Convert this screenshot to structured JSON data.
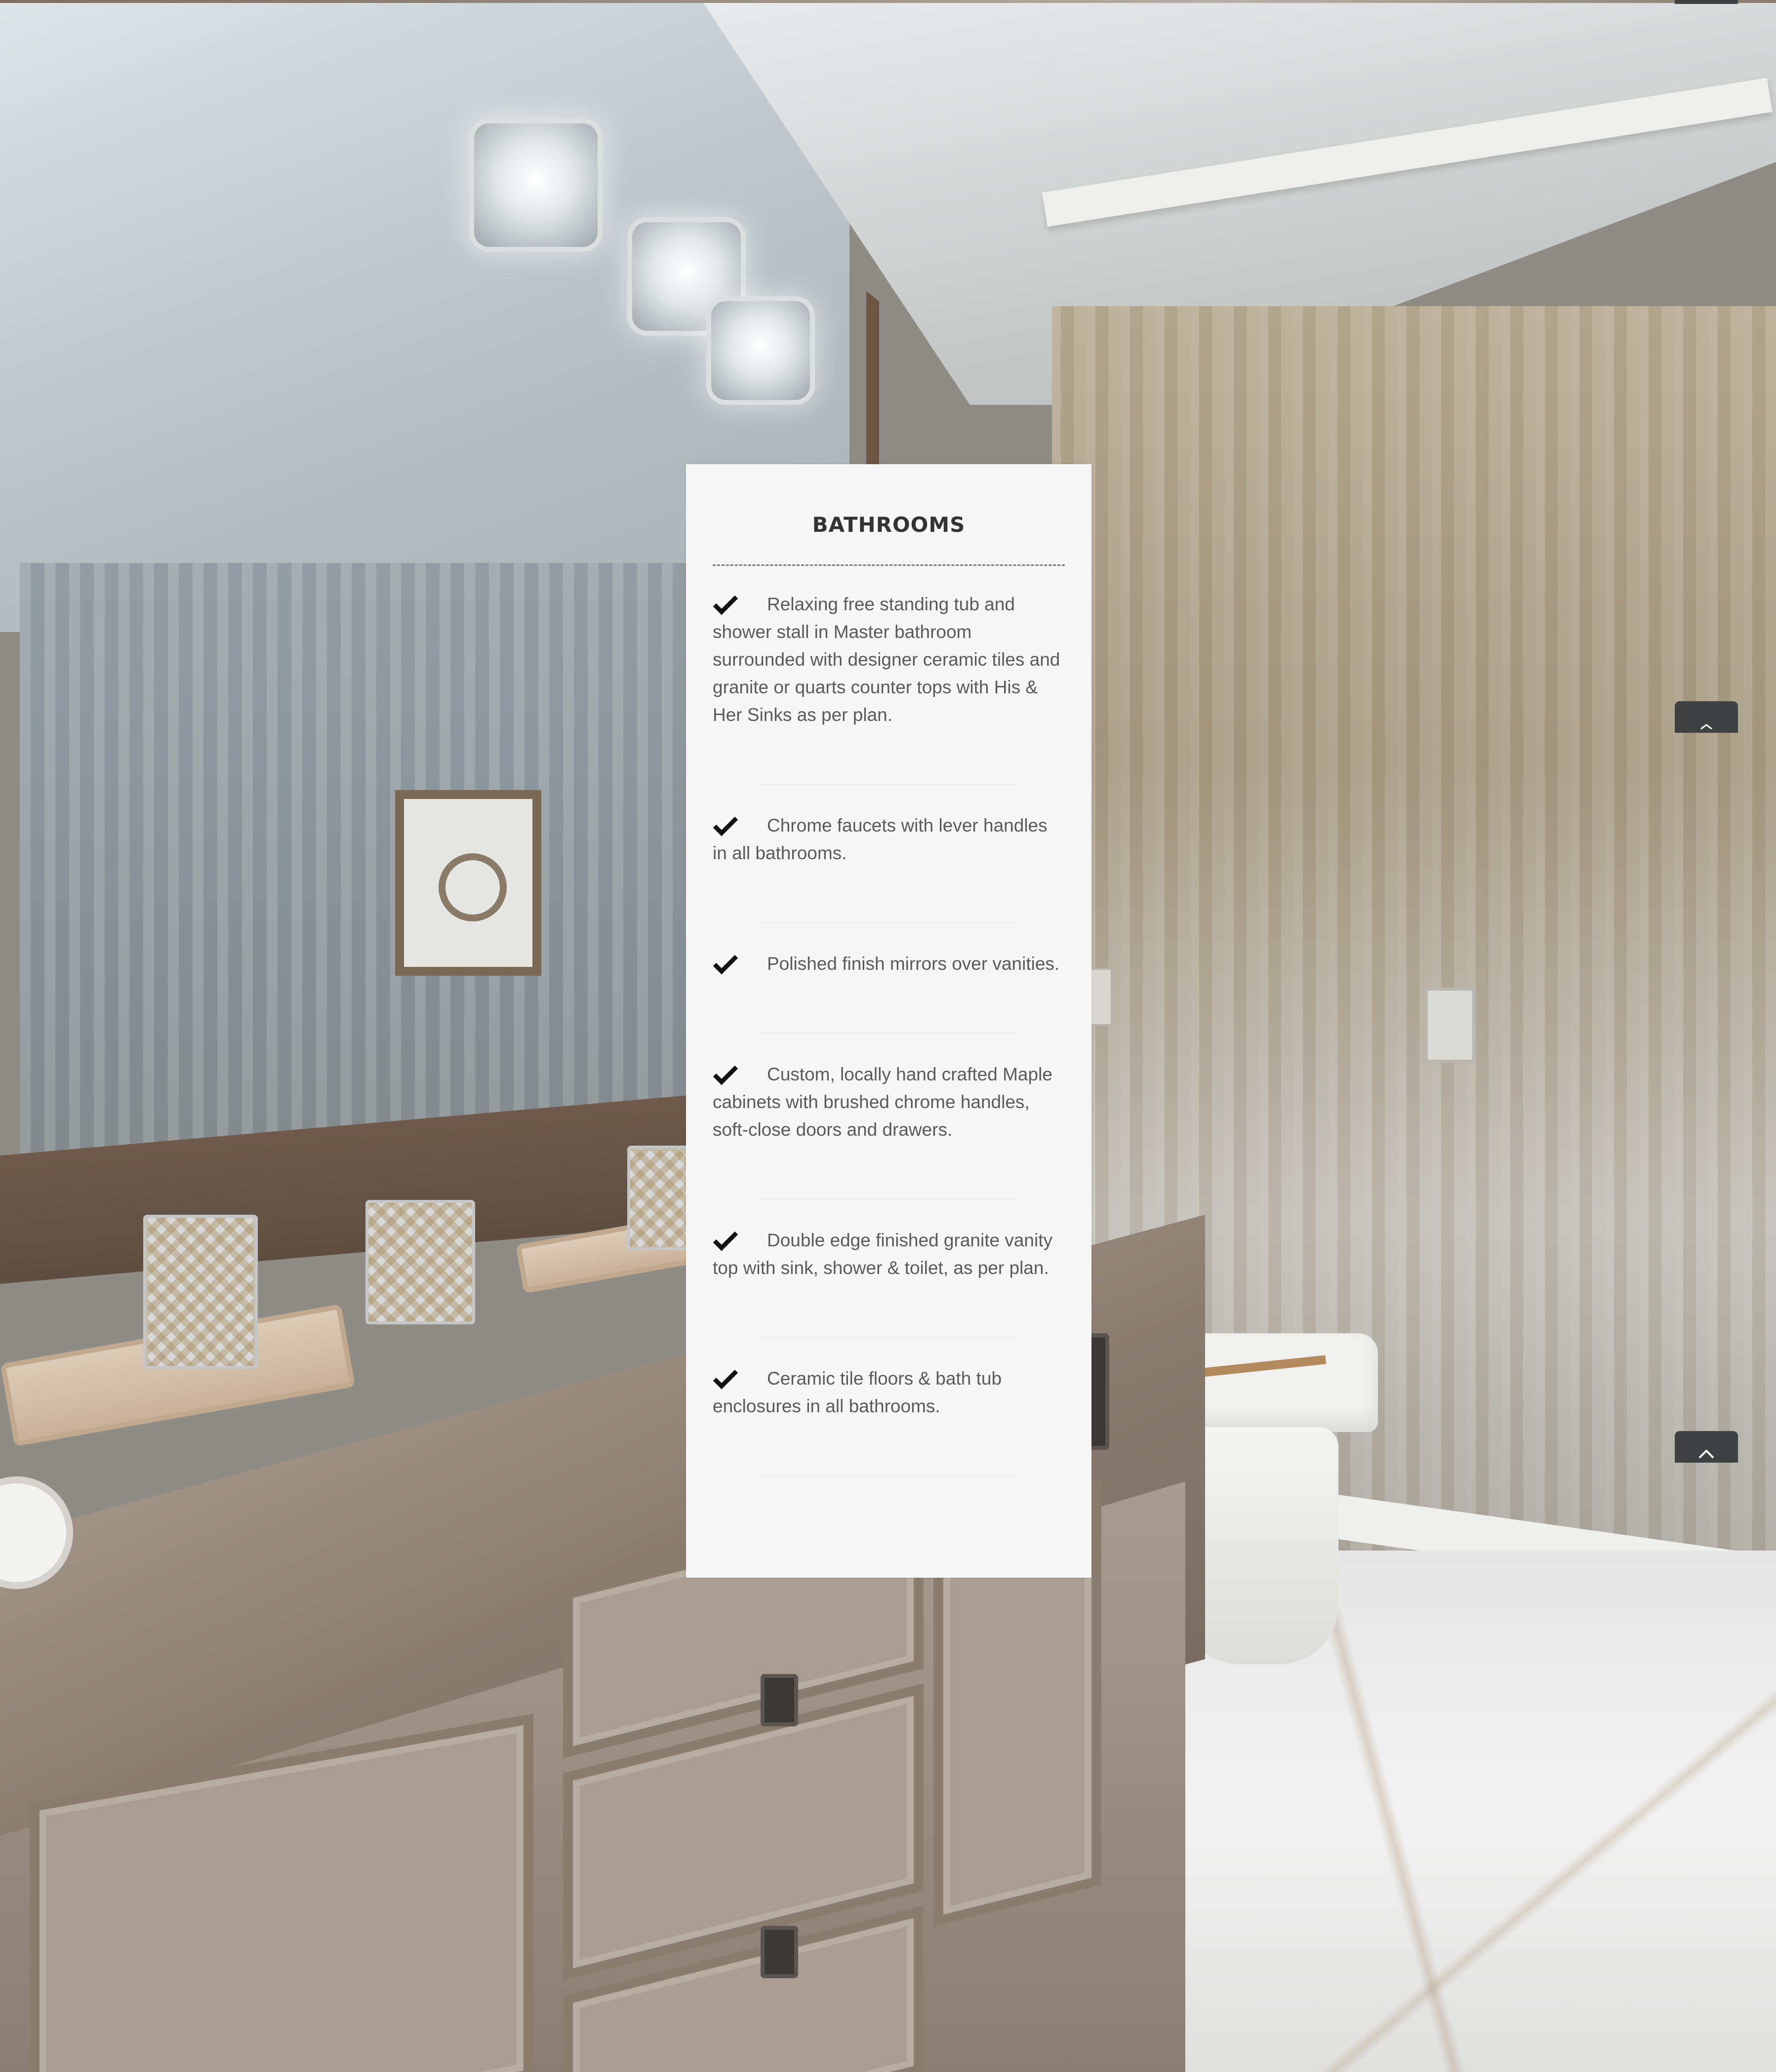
{
  "card": {
    "title": "BATHROOMS",
    "features": [
      {
        "text": "Relaxing free standing tub and shower stall in Master bathroom surrounded with designer ceramic tiles  and granite or quarts counter tops with His & Her Sinks as per plan."
      },
      {
        "text": "Chrome faucets with lever handles in all bathrooms."
      },
      {
        "text": "Polished finish mirrors over vanities."
      },
      {
        "text": "Custom, locally hand crafted Maple cabinets with brushed chrome handles, soft-close doors and drawers."
      },
      {
        "text": "Double edge finished granite vanity top with sink, shower & toilet, as per plan."
      },
      {
        "text": "Ceramic tile floors & bath tub enclosures in all bathrooms."
      }
    ]
  },
  "icons": {
    "feature_bullet": "checkmark-icon",
    "side_button_mid": "chevron-up-icon",
    "side_button_bottom": "chevron-up-icon"
  },
  "colors": {
    "card_background": "#f7f7f7",
    "title_text": "#333333",
    "body_text": "#5a5a5a",
    "side_button": "#3f4142"
  }
}
